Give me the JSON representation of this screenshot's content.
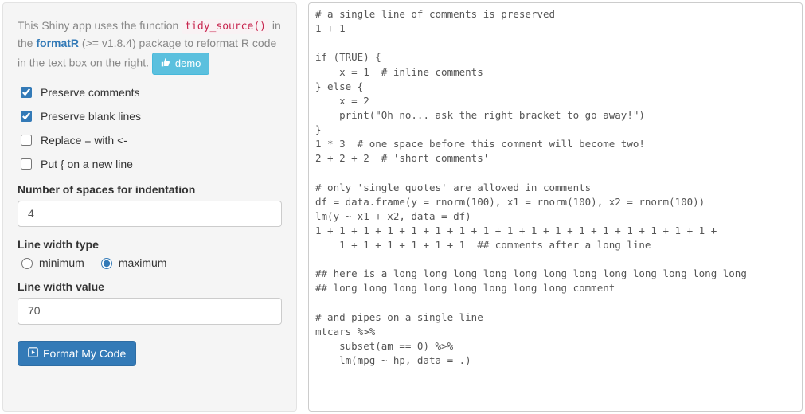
{
  "intro": {
    "prefix": "This Shiny app uses the function ",
    "fn": "tidy_source()",
    "mid1": " in the ",
    "link_text": "formatR",
    "mid2": " (>= v1.8.4) package to reformat R code in the text box on the right. ",
    "demo_label": "demo"
  },
  "checkboxes": {
    "preserve_comments": {
      "label": "Preserve comments",
      "checked": true
    },
    "preserve_blank": {
      "label": "Preserve blank lines",
      "checked": true
    },
    "replace_assign": {
      "label": "Replace = with <-",
      "checked": false
    },
    "brace_newline": {
      "label": "Put { on a new line",
      "checked": false
    }
  },
  "indent": {
    "label": "Number of spaces for indentation",
    "value": "4"
  },
  "width_type": {
    "label": "Line width type",
    "options": {
      "min": "minimum",
      "max": "maximum"
    },
    "selected": "max"
  },
  "width_value": {
    "label": "Line width value",
    "value": "70"
  },
  "submit_label": "Format My Code",
  "code": "# a single line of comments is preserved\n1 + 1\n\nif (TRUE) {\n    x = 1  # inline comments\n} else {\n    x = 2\n    print(\"Oh no... ask the right bracket to go away!\")\n}\n1 * 3  # one space before this comment will become two!\n2 + 2 + 2  # 'short comments'\n\n# only 'single quotes' are allowed in comments\ndf = data.frame(y = rnorm(100), x1 = rnorm(100), x2 = rnorm(100))\nlm(y ~ x1 + x2, data = df)\n1 + 1 + 1 + 1 + 1 + 1 + 1 + 1 + 1 + 1 + 1 + 1 + 1 + 1 + 1 + 1 + 1 +\n    1 + 1 + 1 + 1 + 1 + 1  ## comments after a long line\n\n## here is a long long long long long long long long long long long long\n## long long long long long long long long comment\n\n# and pipes on a single line\nmtcars %>%\n    subset(am == 0) %>%\n    lm(mpg ~ hp, data = .)"
}
